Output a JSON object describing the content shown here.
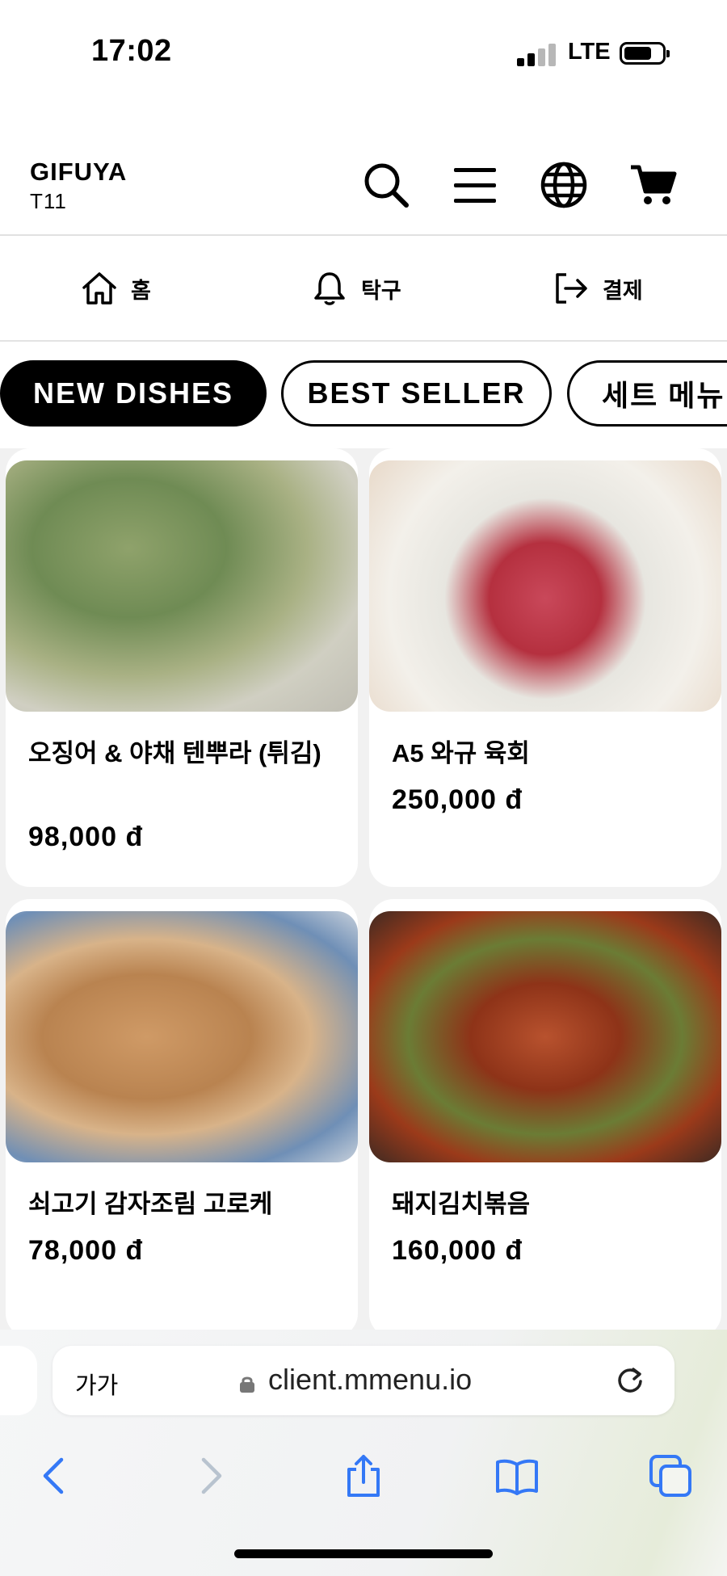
{
  "status_bar": {
    "time": "17:02",
    "network": "LTE"
  },
  "header": {
    "brand": "GIFUYA",
    "table": "T11"
  },
  "nav": [
    {
      "icon": "home-icon",
      "label": "홈"
    },
    {
      "icon": "bell-icon",
      "label": "탁구"
    },
    {
      "icon": "logout-icon",
      "label": "결제"
    }
  ],
  "chips": [
    {
      "label": "NEW DISHES",
      "active": true
    },
    {
      "label": "BEST SELLER",
      "active": false
    },
    {
      "label": "세트 메뉴",
      "active": false
    }
  ],
  "items": [
    {
      "name": "오징어 & 야채 텐뿌라 (튀김)",
      "price": "98,000 đ"
    },
    {
      "name": "A5 와규 육회",
      "price": "250,000 đ"
    },
    {
      "name": "쇠고기 감자조림 고로케",
      "price": "78,000 đ"
    },
    {
      "name": "돼지김치볶음",
      "price": "160,000 đ"
    }
  ],
  "browser": {
    "text_size_label": "가가",
    "url": "client.mmenu.io"
  },
  "colors": {
    "accent_ios": "#3478f6",
    "disabled_ios": "#b8c3cf",
    "card_bg": "#ffffff",
    "grid_bg": "#f1f1f1"
  }
}
